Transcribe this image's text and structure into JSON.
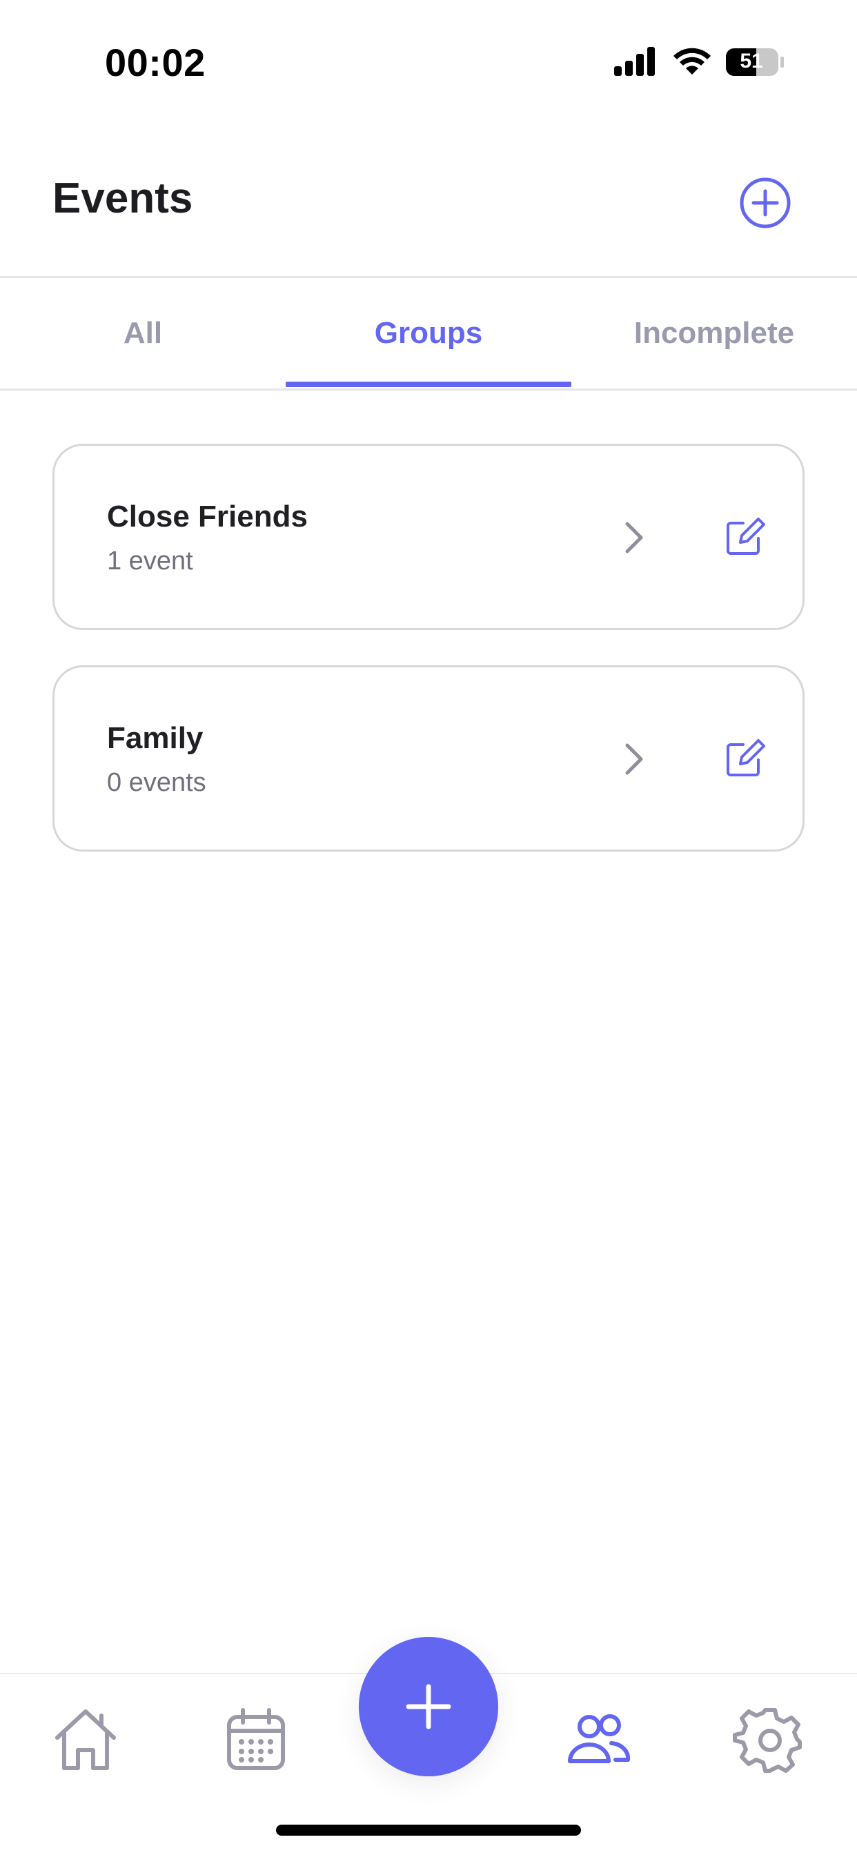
{
  "status_bar": {
    "time": "00:02",
    "battery_level": "51",
    "icons": [
      "signal-icon",
      "wifi-icon",
      "battery-icon"
    ]
  },
  "header": {
    "title": "Events",
    "add_icon": "plus-circle-icon"
  },
  "tabs": [
    {
      "label": "All",
      "selected": false
    },
    {
      "label": "Groups",
      "selected": true
    },
    {
      "label": "Incomplete",
      "selected": false
    }
  ],
  "groups": [
    {
      "name": "Close Friends",
      "count": "1 event"
    },
    {
      "name": "Family",
      "count": "0 events"
    }
  ],
  "bottom_nav": {
    "items": [
      {
        "icon": "home-icon",
        "active": false
      },
      {
        "icon": "calendar-icon",
        "active": false
      },
      {
        "icon": "plus-icon",
        "active": true
      },
      {
        "icon": "users-icon",
        "active": true
      },
      {
        "icon": "gear-icon",
        "active": false
      }
    ]
  },
  "colors": {
    "accent": "#6366f1",
    "inactive": "#9a9aae",
    "text": "#1f1f24",
    "muted": "#6f6f7e",
    "border": "#d6d6dc"
  }
}
